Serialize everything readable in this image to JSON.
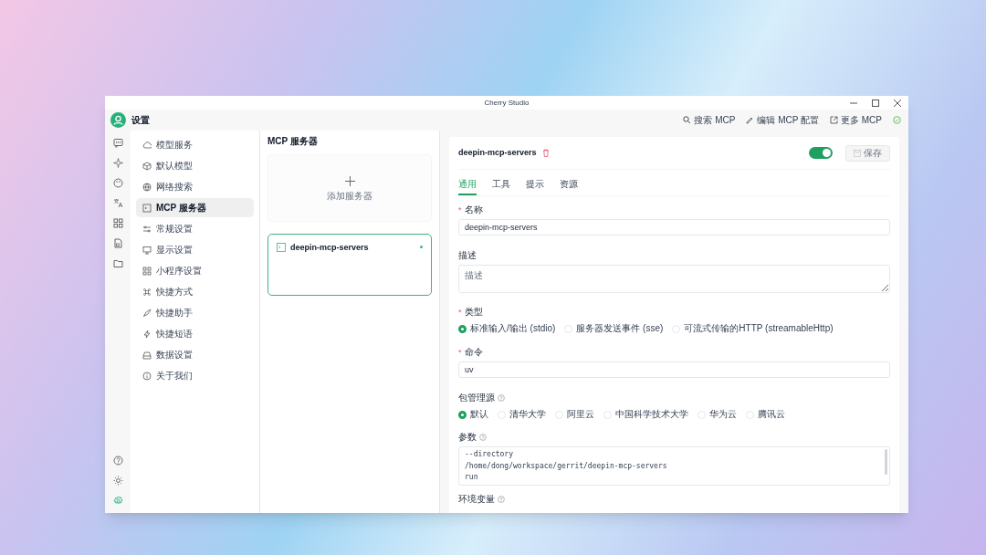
{
  "window": {
    "title": "Cherry Studio"
  },
  "header": {
    "title": "设置",
    "actions": [
      {
        "label": "搜索 MCP"
      },
      {
        "label": "编辑 MCP 配置"
      },
      {
        "label": "更多 MCP"
      }
    ],
    "status_ok": true
  },
  "rail": {
    "top": [
      {
        "selected": false
      },
      {
        "selected": false
      },
      {
        "selected": false
      },
      {
        "selected": false
      },
      {
        "selected": false
      },
      {
        "selected": false
      },
      {
        "selected": false
      }
    ],
    "bottom": [
      {
        "selected": false
      },
      {
        "selected": false
      },
      {
        "selected": true
      }
    ]
  },
  "settings_menu": [
    {
      "label": "模型服务",
      "selected": false
    },
    {
      "label": "默认模型",
      "selected": false
    },
    {
      "label": "网络搜索",
      "selected": false
    },
    {
      "label": "MCP 服务器",
      "selected": true
    },
    {
      "label": "常规设置",
      "selected": false
    },
    {
      "label": "显示设置",
      "selected": false
    },
    {
      "label": "小程序设置",
      "selected": false
    },
    {
      "label": "快捷方式",
      "selected": false
    },
    {
      "label": "快捷助手",
      "selected": false
    },
    {
      "label": "快捷短语",
      "selected": false
    },
    {
      "label": "数据设置",
      "selected": false
    },
    {
      "label": "关于我们",
      "selected": false
    }
  ],
  "servers_panel": {
    "title": "MCP 服务器",
    "add_label": "添加服务器",
    "servers": [
      {
        "name": "deepin-mcp-servers",
        "selected": true,
        "active": true
      }
    ]
  },
  "detail": {
    "name": "deepin-mcp-servers",
    "required_marker": "*",
    "enabled": true,
    "save": {
      "label": "保存",
      "disabled": true
    },
    "tabs": [
      {
        "label": "通用",
        "selected": true
      },
      {
        "label": "工具",
        "selected": false
      },
      {
        "label": "提示",
        "selected": false
      },
      {
        "label": "资源",
        "selected": false
      }
    ],
    "fields": [
      {
        "kind": "text",
        "label": "名称",
        "required": true,
        "value": "deepin-mcp-servers"
      },
      {
        "kind": "textarea",
        "label": "描述",
        "required": false,
        "placeholder": "描述"
      },
      {
        "kind": "radio",
        "label": "类型",
        "required": true,
        "options": [
          {
            "label": "标准输入/输出 (stdio)",
            "selected": true
          },
          {
            "label": "服务器发送事件 (sse)",
            "selected": false
          },
          {
            "label": "可流式传输的HTTP (streamableHttp)",
            "selected": false
          }
        ]
      },
      {
        "kind": "text",
        "label": "命令",
        "required": true,
        "value": "uv"
      },
      {
        "kind": "radio",
        "label": "包管理源",
        "help": true,
        "options": [
          {
            "label": "默认",
            "selected": true
          },
          {
            "label": "清华大学",
            "selected": false
          },
          {
            "label": "阿里云",
            "selected": false
          },
          {
            "label": "中国科学技术大学",
            "selected": false
          },
          {
            "label": "华为云",
            "selected": false
          },
          {
            "label": "腾讯云",
            "selected": false
          }
        ]
      },
      {
        "kind": "code",
        "label": "参数",
        "help": true,
        "lines": [
          "--directory",
          "/home/dong/workspace/gerrit/deepin-mcp-servers",
          "run"
        ]
      },
      {
        "kind": "label",
        "label": "环境变量",
        "help": true
      }
    ]
  }
}
